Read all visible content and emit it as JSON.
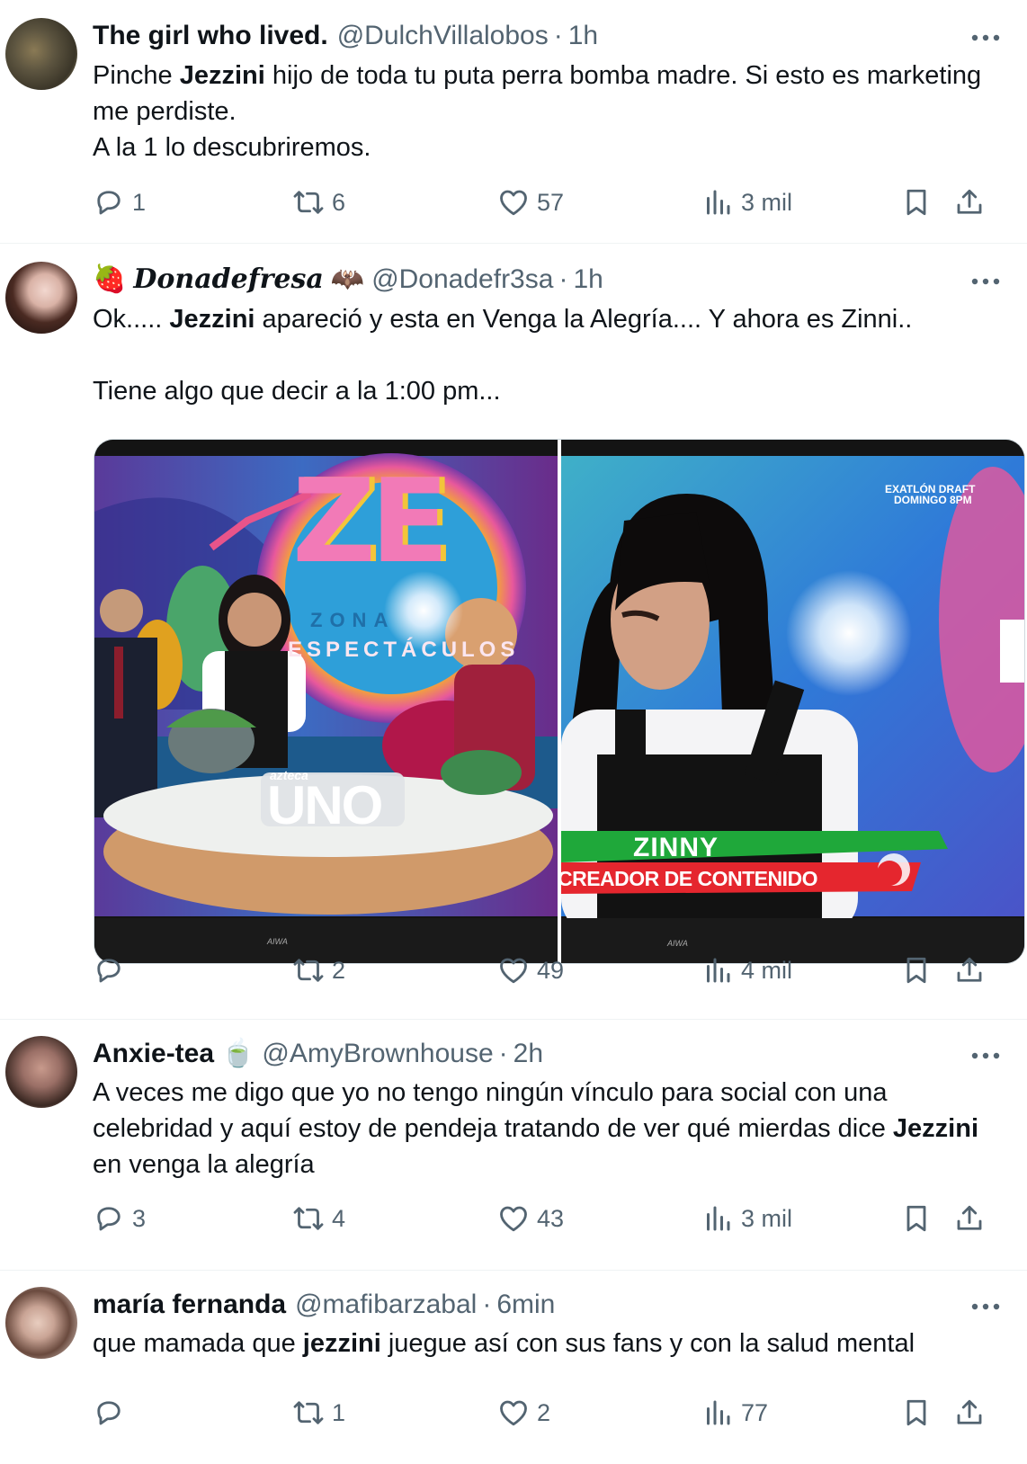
{
  "tweets": [
    {
      "name": "The girl who lived.",
      "handle": "@DulchVillalobos",
      "time": "1h",
      "body": [
        {
          "t": "Pinche "
        },
        {
          "t": "Jezzini",
          "b": true
        },
        {
          "t": " hijo de toda tu puta perra bomba madre. Si esto es marketing me perdiste."
        },
        {
          "br": true
        },
        {
          "t": "A la 1 lo descubriremos."
        }
      ],
      "replies": "1",
      "retweets": "6",
      "likes": "57",
      "views": "3 mil"
    },
    {
      "name": "Donadefresa",
      "name_emoji_before": "🍓",
      "name_emoji_after": "🦇",
      "handle": "@Donadefr3sa",
      "time": "1h",
      "body": [
        {
          "t": "Ok..... "
        },
        {
          "t": "Jezzini",
          "b": true
        },
        {
          "t": " apareció y esta en Venga la Alegría.... Y ahora es Zinni.."
        },
        {
          "br": true
        },
        {
          "br": true
        },
        {
          "t": "Tiene algo que decir a la 1:00 pm..."
        }
      ],
      "media": {
        "left": {
          "logo_text": "ZE",
          "logo_sub": "ZONA",
          "logo_sub2": "ESPECTÁCULOS",
          "channel": "azteca",
          "channel_big": "UNO",
          "brand": "AIWA"
        },
        "right": {
          "corner_line1": "EXATLÓN DRAFT",
          "corner_line2": "DOMINGO 8PM",
          "lower_third_name": "ZINNY",
          "lower_third_role": "CREADOR DE CONTENIDO",
          "brand": "AIWA"
        }
      },
      "replies": "",
      "retweets": "2",
      "likes": "49",
      "views": "4 mil"
    },
    {
      "name": "Anxie-tea",
      "name_emoji_after": "🍵",
      "handle": "@AmyBrownhouse",
      "time": "2h",
      "body": [
        {
          "t": "A veces me digo que yo no tengo ningún vínculo para social con una celebridad y aquí estoy de pendeja tratando de ver qué mierdas dice "
        },
        {
          "t": "Jezzini",
          "b": true
        },
        {
          "t": " en venga la alegría"
        }
      ],
      "replies": "3",
      "retweets": "4",
      "likes": "43",
      "views": "3 mil"
    },
    {
      "name": "maría fernanda",
      "handle": "@mafibarzabal",
      "time": "6min",
      "body": [
        {
          "t": "que mamada que "
        },
        {
          "t": "jezzini",
          "b": true
        },
        {
          "t": " juegue así con sus fans y con la salud mental"
        }
      ],
      "replies": "",
      "retweets": "1",
      "likes": "2",
      "views": "77"
    }
  ],
  "colors": {
    "text": "#0f1419",
    "secondary": "#536471",
    "divider": "#eff3f4",
    "lower_third_green": "#1fa83a",
    "lower_third_red": "#e5262e"
  },
  "icons": [
    "more-icon",
    "reply-icon",
    "retweet-icon",
    "like-icon",
    "views-icon",
    "bookmark-icon",
    "share-icon"
  ]
}
